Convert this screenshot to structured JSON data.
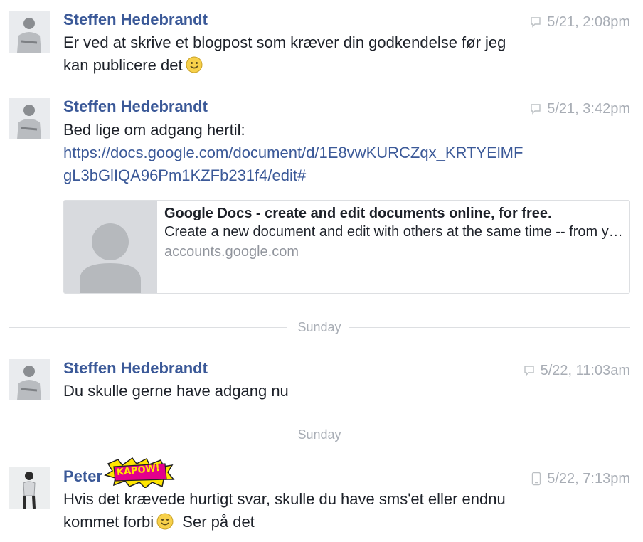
{
  "messages": [
    {
      "sender": "Steffen Hedebrandt",
      "time": "5/21, 2:08pm",
      "source_icon": "comment-icon",
      "lines": [
        "Er ved at skrive et blogpost som kræver din godkendelse før jeg",
        "kan publicere det"
      ],
      "emoji": "smiley-emoji"
    },
    {
      "sender": "Steffen Hedebrandt",
      "time": "5/21, 3:42pm",
      "source_icon": "comment-icon",
      "lines": [
        "Bed lige om adgang hertil:"
      ],
      "link_lines": [
        "https://docs.google.com/document/d/1E8vwKURCZqx_KRTYElMF",
        "gL3bGlIQA96Pm1KZFb231f4/edit#"
      ],
      "preview": {
        "title": "Google Docs - create and edit documents online, for free.",
        "description": "Create a new document and edit with others at the same time -- from your computer, phone or tablet",
        "domain": "accounts.google.com"
      }
    },
    {
      "sender": "Steffen Hedebrandt",
      "time": "5/22, 11:03am",
      "source_icon": "comment-icon",
      "lines": [
        "Du skulle gerne have adgang nu"
      ]
    },
    {
      "sender": "Peter",
      "time": "5/22, 7:13pm",
      "source_icon": "mobile-phone-icon",
      "badge": "KAPOW!",
      "lines": [
        "Hvis det krævede hurtigt svar, skulle du have sms'et eller endnu",
        "kommet forbi"
      ],
      "trailing_text": "Ser på det",
      "emoji": "smiley-emoji"
    }
  ],
  "dividers": [
    {
      "label": "Sunday"
    },
    {
      "label": "Sunday"
    }
  ],
  "colors": {
    "sender": "#3b5998",
    "link": "#3b5998",
    "meta": "#a8adb5",
    "divider": "#dddfe2"
  }
}
